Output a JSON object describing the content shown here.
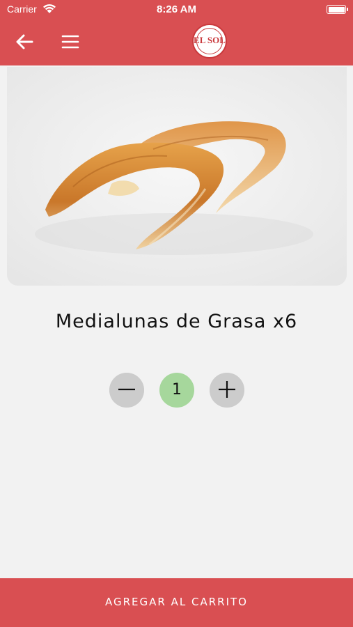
{
  "status_bar": {
    "carrier": "Carrier",
    "time": "8:26 AM"
  },
  "nav": {
    "logo_text": "EL SOL",
    "back_icon": "arrow-left-icon",
    "menu_icon": "hamburger-menu-icon"
  },
  "product": {
    "name": "Medialunas de Grasa x6",
    "image_subject": "croissants"
  },
  "quantity": {
    "value": "1"
  },
  "cta": {
    "label": "AGREGAR AL CARRITO"
  },
  "colors": {
    "brand_red": "#d94f52",
    "quantity_green": "#a6d79c",
    "stepper_gray": "#cccccc",
    "background": "#f2f2f2"
  }
}
